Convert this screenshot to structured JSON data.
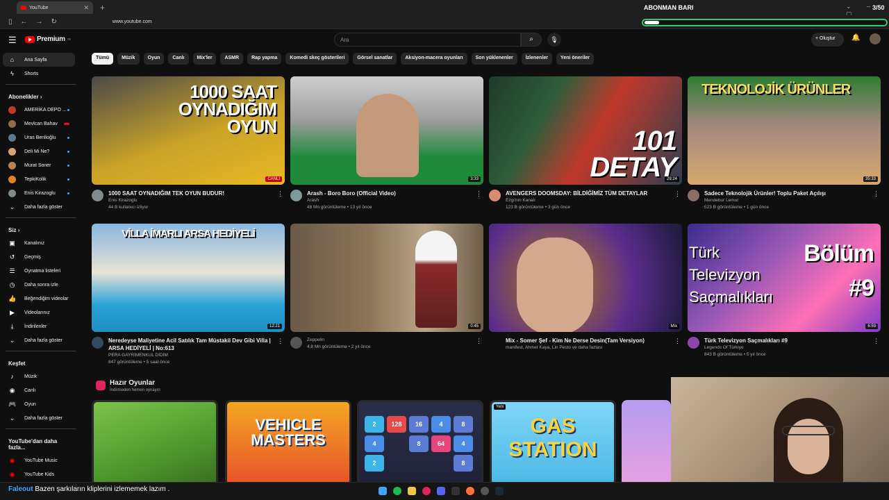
{
  "browser": {
    "tab_title": "YouTube",
    "url": "www.youtube.com",
    "tab_counter": "3/50",
    "overlay_title": "ABONMAN BARI",
    "overlay_progress": 0.06
  },
  "header": {
    "logo_text": "Premium",
    "logo_badge": "TR",
    "search_placeholder": "Ara",
    "create_label": "Oluştur"
  },
  "chips": [
    "Tümü",
    "Müzik",
    "Oyun",
    "Canlı",
    "Mix'ler",
    "ASMR",
    "Rap yapma",
    "Komedi skeç gösterileri",
    "Görsel sanatlar",
    "Aksiyon-macera oyunları",
    "Son yüklenenler",
    "İzlenenler",
    "Yeni öneriler"
  ],
  "sidebar": {
    "main": [
      {
        "label": "Ana Sayfa",
        "icon": "home-icon"
      },
      {
        "label": "Shorts",
        "icon": "shorts-icon"
      }
    ],
    "subs_header": "Abonelikler",
    "subs": [
      {
        "label": "AMERİKA DEPO ...",
        "color": "#c0392b",
        "dot": "blue"
      },
      {
        "label": "Mevlcan Bahav",
        "color": "#8e6d4a",
        "dot": "live"
      },
      {
        "label": "Uras Benlioğlu",
        "color": "#5d7a8c",
        "dot": "blue"
      },
      {
        "label": "Deli Mi Ne?",
        "color": "#d4a373",
        "dot": "blue"
      },
      {
        "label": "Murat Soner",
        "color": "#b5835a",
        "dot": "blue"
      },
      {
        "label": "TepkiKolik",
        "color": "#e67e22",
        "dot": "blue"
      },
      {
        "label": "Enis Kirazoglu",
        "color": "#7f8c8d",
        "dot": "blue"
      }
    ],
    "subs_more": "Daha fazla göster",
    "you_header": "Siz",
    "you": [
      {
        "label": "Kanalınız",
        "icon": "channel-icon"
      },
      {
        "label": "Geçmiş",
        "icon": "history-icon"
      },
      {
        "label": "Oynatma listeleri",
        "icon": "playlist-icon"
      },
      {
        "label": "Daha sonra izle",
        "icon": "clock-icon"
      },
      {
        "label": "Beğendiğim videolar",
        "icon": "like-icon"
      },
      {
        "label": "Videolarınız",
        "icon": "video-icon"
      },
      {
        "label": "İndirilenler",
        "icon": "download-icon"
      },
      {
        "label": "Daha fazla göster",
        "icon": "chevron-down-icon"
      }
    ],
    "explore_header": "Keşfet",
    "explore": [
      {
        "label": "Müzik",
        "icon": "music-icon"
      },
      {
        "label": "Canlı",
        "icon": "live-icon"
      },
      {
        "label": "Oyun",
        "icon": "gaming-icon"
      },
      {
        "label": "Daha fazla göster",
        "icon": "chevron-down-icon"
      }
    ],
    "more_header": "YouTube'dan daha fazla...",
    "more": [
      {
        "label": "YouTube Music",
        "icon": "youtube-music-icon"
      },
      {
        "label": "YouTube Kids",
        "icon": "youtube-kids-icon"
      }
    ]
  },
  "videos": [
    {
      "title": "1000 SAAT OYNADIĞIM TEK OYUN BUDUR!",
      "channel": "Enis Kirazoglu",
      "stats": "44 B kullanıcı izliyor",
      "duration": "CANLI",
      "thumb_text": "1000 SAAT\nOYNADIĞIM\nOYUN",
      "bg": "linear-gradient(160deg,#4a4a4a 0%,#c9a227 55%,#e8b923 100%)",
      "av": "#7f8c8d",
      "live": true
    },
    {
      "title": "Arash - Boro Boro (Official Video)",
      "channel": "Arash",
      "stats": "48 Mn görüntüleme • 13 yıl önce",
      "duration": "3:33",
      "thumb_text": "",
      "bg": "linear-gradient(180deg,#cfcfcf 0%,#9e9e9e 40%,#1e8a3a 75%,#1e8a3a 100%)",
      "av": "#7d9a9a",
      "live": false
    },
    {
      "title": "AVENGERS DOOMSDAY: BİLDİĞİMİZ TÜM DETAYLAR",
      "channel": "Ezgi'nin Kanalı",
      "stats": "123 B görüntüleme • 3 gün önce",
      "duration": "29:24",
      "thumb_text": "101\nDETAY",
      "bg": "linear-gradient(120deg,#1d3b2a 0%,#2f5d3a 30%,#c0392b 55%,#2c3e50 100%)",
      "av": "#d98c6f",
      "live": false
    },
    {
      "title": "Sadece Teknolojik Ürünler! Toplu Paket Açılışı",
      "channel": "Mendebur Lemur",
      "stats": "523 B görüntüleme • 1 gün önce",
      "duration": "35:33",
      "thumb_text": "TEKNOLOJİK ÜRÜNLER",
      "bg": "linear-gradient(180deg,#2e7d32 0%,#a1887f 45%,#d7a86e 100%)",
      "av": "#8d6e63",
      "live": false
    },
    {
      "title": "Neredeyse Maliyetine Acil Satılık Tam Müstakil Dev Gibi Villa | ARSA HEDİYELİ | No:613",
      "channel": "PERA GAYRİMENKUL DİDİM",
      "stats": "847 görüntüleme • 5 saat önce",
      "duration": "12:21",
      "thumb_text": "VİLLA İMARLI ARSA HEDİYELİ",
      "bg": "linear-gradient(180deg,#87b7e0 0%,#e8e2d5 45%,#29a3d6 75%,#1f8fc0 100%)",
      "av": "#34495e",
      "live": false
    },
    {
      "title": "",
      "channel": "Zeppelin",
      "stats": "4,8 Mn görüntüleme • 2 yıl önce",
      "duration": "0:45",
      "thumb_text": "",
      "bg": "linear-gradient(90deg,#6b5a45 0%,#8c7458 40%,#b9a58a 70%,#6e5b46 100%)",
      "av": "#555",
      "live": false
    },
    {
      "title": "Mix - Somer Şef - Kim Ne Derse Desin(Tam Versiyon)",
      "channel": "manifest, Ahmet Kaya, Lin Pesto ve daha fazlası",
      "stats": "",
      "duration": "Mix",
      "thumb_text": "",
      "bg": "radial-gradient(circle at 35% 55%,#d9a58a 0%,#8a5a4a 25%,#5b2d8c 55%,#1a1a3a 100%)",
      "av": "",
      "live": false
    },
    {
      "title": "Türk Televizyon Saçmalıkları #9",
      "channel": "Legends Of Türkiye",
      "stats": "843 B görüntüleme • 5 yıl önce",
      "duration": "6:59",
      "thumb_text": "Türk\nTelevizyon\nSaçmalıkları",
      "bg": "linear-gradient(135deg,#3b2c8f 0%,#9b59b6 40%,#ff6fb5 70%,#7d3cc4 100%)",
      "av": "#8e44ad",
      "live": false
    }
  ],
  "video8_badge": "Bölüm #9",
  "games_section": {
    "title": "Hazır Oyunlar",
    "subtitle": "İndirmeden hemen oynayın",
    "games": [
      {
        "label": "",
        "bg": "linear-gradient(160deg,#7cc34a 0%,#4e9a2e 60%,#3b6e22 100%)",
        "badge": ""
      },
      {
        "label": "VEHICLE MASTERS",
        "bg": "linear-gradient(180deg,#f5a623 0%,#e8532a 100%)",
        "badge": ""
      },
      {
        "label": "",
        "bg": "linear-gradient(180deg,#2c2f4a 0%,#1f2238 100%)",
        "badge": ""
      },
      {
        "label": "GAS STATION",
        "bg": "linear-gradient(180deg,#7fd6f7 0%,#4cb8e6 100%)",
        "badge": "Yeni"
      }
    ]
  },
  "game_tiles": [
    "2",
    "128",
    "16",
    "4",
    "8",
    "4",
    "8",
    "64",
    "4",
    "2",
    "8"
  ],
  "ticker": {
    "name": "Faleout",
    "message": "Bazen şarkıların kliplerini izlememek lazım ."
  }
}
